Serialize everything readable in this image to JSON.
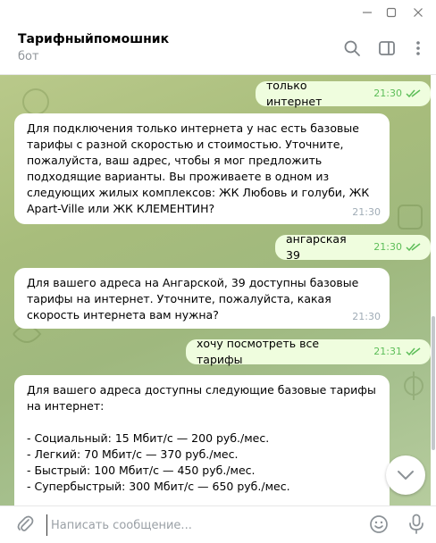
{
  "header": {
    "title": "Тарифныйпомошник",
    "subtitle": "бот"
  },
  "messages": [
    {
      "direction": "out",
      "text": "только интернет",
      "time": "21:30"
    },
    {
      "direction": "in",
      "text": "Для подключения только интернета у нас есть базовые тарифы с разной скоростью и стоимостью. Уточните, пожалуйста, ваш адрес, чтобы я мог предложить подходящие варианты. Вы проживаете в одном из следующих жилых комплексов: ЖК Любовь и голуби, ЖК Apart-Ville или ЖК КЛЕМЕНТИН?",
      "time": "21:30"
    },
    {
      "direction": "out",
      "text": "ангарская 39",
      "time": "21:30"
    },
    {
      "direction": "in",
      "text": "Для вашего адреса на Ангарской, 39 доступны базовые тарифы на интернет. Уточните, пожалуйста, какая скорость интернета вам нужна?",
      "time": "21:30"
    },
    {
      "direction": "out",
      "text": "хочу посмотреть все тарифы",
      "time": "21:31"
    },
    {
      "direction": "in",
      "text": "Для вашего адреса доступны следующие базовые тарифы на интернет:\n\n- Социальный: 15 Мбит/с — 200 руб./мес.\n- Легкий: 70 Мбит/с — 370 руб./мес.\n- Быстрый: 100 Мбит/с — 450 руб./мес.\n- Супербыстрый: 300 Мбит/с — 650 руб./мес.",
      "time": ""
    }
  ],
  "composer": {
    "placeholder": "Написать сообщение..."
  },
  "colors": {
    "outgoing_bubble": "#effdde",
    "incoming_bubble": "#ffffff",
    "read_check": "#5dbe59"
  }
}
